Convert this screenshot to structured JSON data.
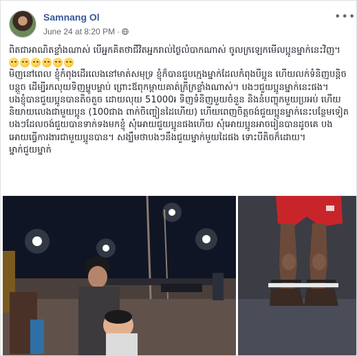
{
  "post": {
    "author": "Samnang Ol",
    "date": "June 24 at 8:20 PM",
    "separator": "·",
    "paragraphs": [
      "ពិតជាអាណិតខ្លាំងណាស់ បើអ្នកគិតថាជីវិតអ្នករាល់ថ្ងៃលំបាកណាស់ ចូលក្រឡេកមើលប្អូនម្នាក់នេះវិញ។",
      "មិញនៅពេល ខ្ញុំកំពុងដើរលេងនៅមាត់សមុទ្រ ខ្ញុំក៏បានជួបក្មេងម្នាក់ដែលកំពុងបីប្អូន ហើយលក់ទំនិញបន្តិចបន្តួច ដើម្បីរកលុយទិញម្ហូបម្ហាប់ ព្រោះឪពុកម្ដាយគាត់ក្រីក្រខ្លាំងណាស់។ បងៗជួយប្អូនម្នាក់នេះផង។",
      "បងខ្ញុំបានជួយប្អូនបានតិចតួច ដោយលុយ 51000៛ ទិញទំនិញមួយចំនួន និងនំបញ្ចុកមួយប្រអប់ ហើយនិយាយលេងជាមួយប្អូន (100ជាង ពាក់ចិញ្ចៀនដៃហើយ) ហើយពេញចិត្តចង់ជួយប្អូនម្នាក់នេះបន្ថែមទៀត បងៗដែលចង់ជួយបានទាក់ទងមកខ្ញុំ សុំអោយជួយប្អូនផងហើយ សុំអោយប្អូនអាចរៀនបានដូចគេ បងអោយធ្វើការងារជាមួយប្អូនបាន។ សង្ឃឹមថាបងៗនឹងជួយម្នាក់មួយដៃផង ទោះបីតិចក៏ដោយ។",
      "ម្នាក់ជួយម្នាក់"
    ],
    "emoji_count": 6,
    "emoji_name": "sad-face-emoji"
  },
  "colors": {
    "author": "#365899",
    "meta": "#616770",
    "text": "#1d2129",
    "card": "#ffffff",
    "page_bg": "#e9ebee"
  },
  "icons": {
    "privacy": "globe-icon",
    "options": "more-options-icon"
  }
}
